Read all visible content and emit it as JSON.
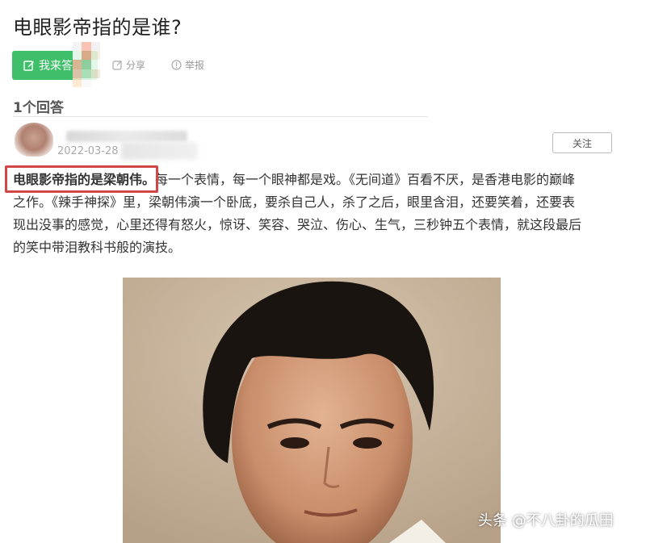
{
  "question": {
    "title": "电眼影帝指的是谁?"
  },
  "actions": {
    "answer_label": "我来答",
    "share_label": "分享",
    "report_label": "举报"
  },
  "answers": {
    "count_label": "1个回答"
  },
  "answer": {
    "date": "2022-03-28",
    "follow_label": "关注",
    "highlight_text": "电眼影帝指的是梁朝伟。",
    "text_rest_line1": "每一个表情，每一个眼神都是戏。《无间道》百看不厌，是香港电影的巅峰",
    "text_line2": "之作。《辣手神探》里，梁朝伟演一个卧底，要杀自己人，杀了之后，眼里含泪，还要笑着，还要表",
    "text_line3": "现出没事的感觉，心里还得有怒火，惊讶、笑容、哭泣、伤心、生气，三秒钟五个表情，就这段最后",
    "text_line4": "的笑中带泪教科书般的演技。"
  },
  "watermark": "头条 @不八卦的瓜田",
  "colors": {
    "accent_green": "#3fbf6a",
    "highlight_red": "#d14646"
  },
  "icons": {
    "edit": "pencil-square-icon",
    "share": "share-icon",
    "report": "info-circle-icon"
  }
}
